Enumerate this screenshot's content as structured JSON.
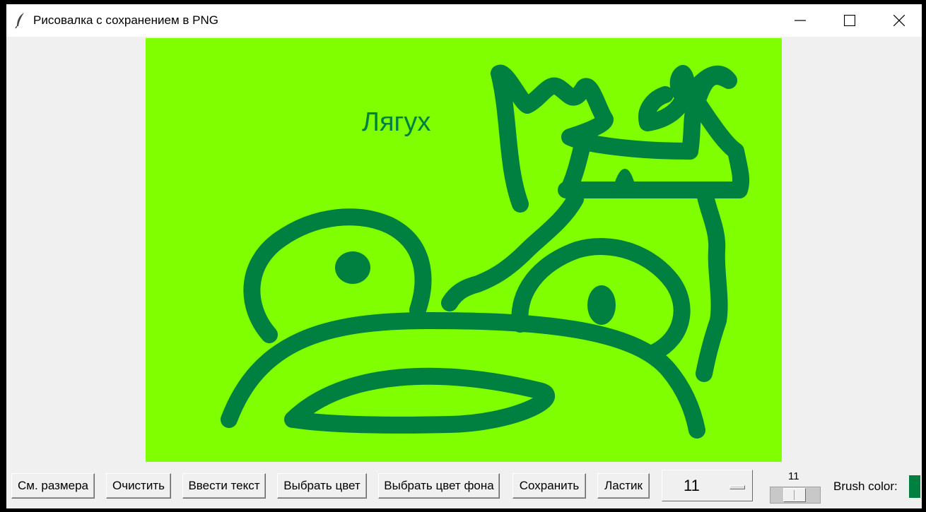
{
  "window": {
    "title": "Рисовалка с сохранением в PNG",
    "controls": [
      "minimize-icon",
      "maximize-icon",
      "close-icon"
    ]
  },
  "canvas": {
    "background_color": "#80ff00",
    "stroke_color": "#008040",
    "text": "Лягух"
  },
  "toolbar": {
    "buttons": [
      {
        "label": "См. размера"
      },
      {
        "label": "Очистить"
      },
      {
        "label": "Ввести текст"
      },
      {
        "label": "Выбрать цвет"
      },
      {
        "label": "Выбрать цвет фона"
      },
      {
        "label": "Сохранить"
      },
      {
        "label": "Ластик"
      }
    ],
    "size_menu_value": "11",
    "scale_value": "11",
    "brush_color_label": "Brush color:",
    "brush_color": "#008040"
  }
}
